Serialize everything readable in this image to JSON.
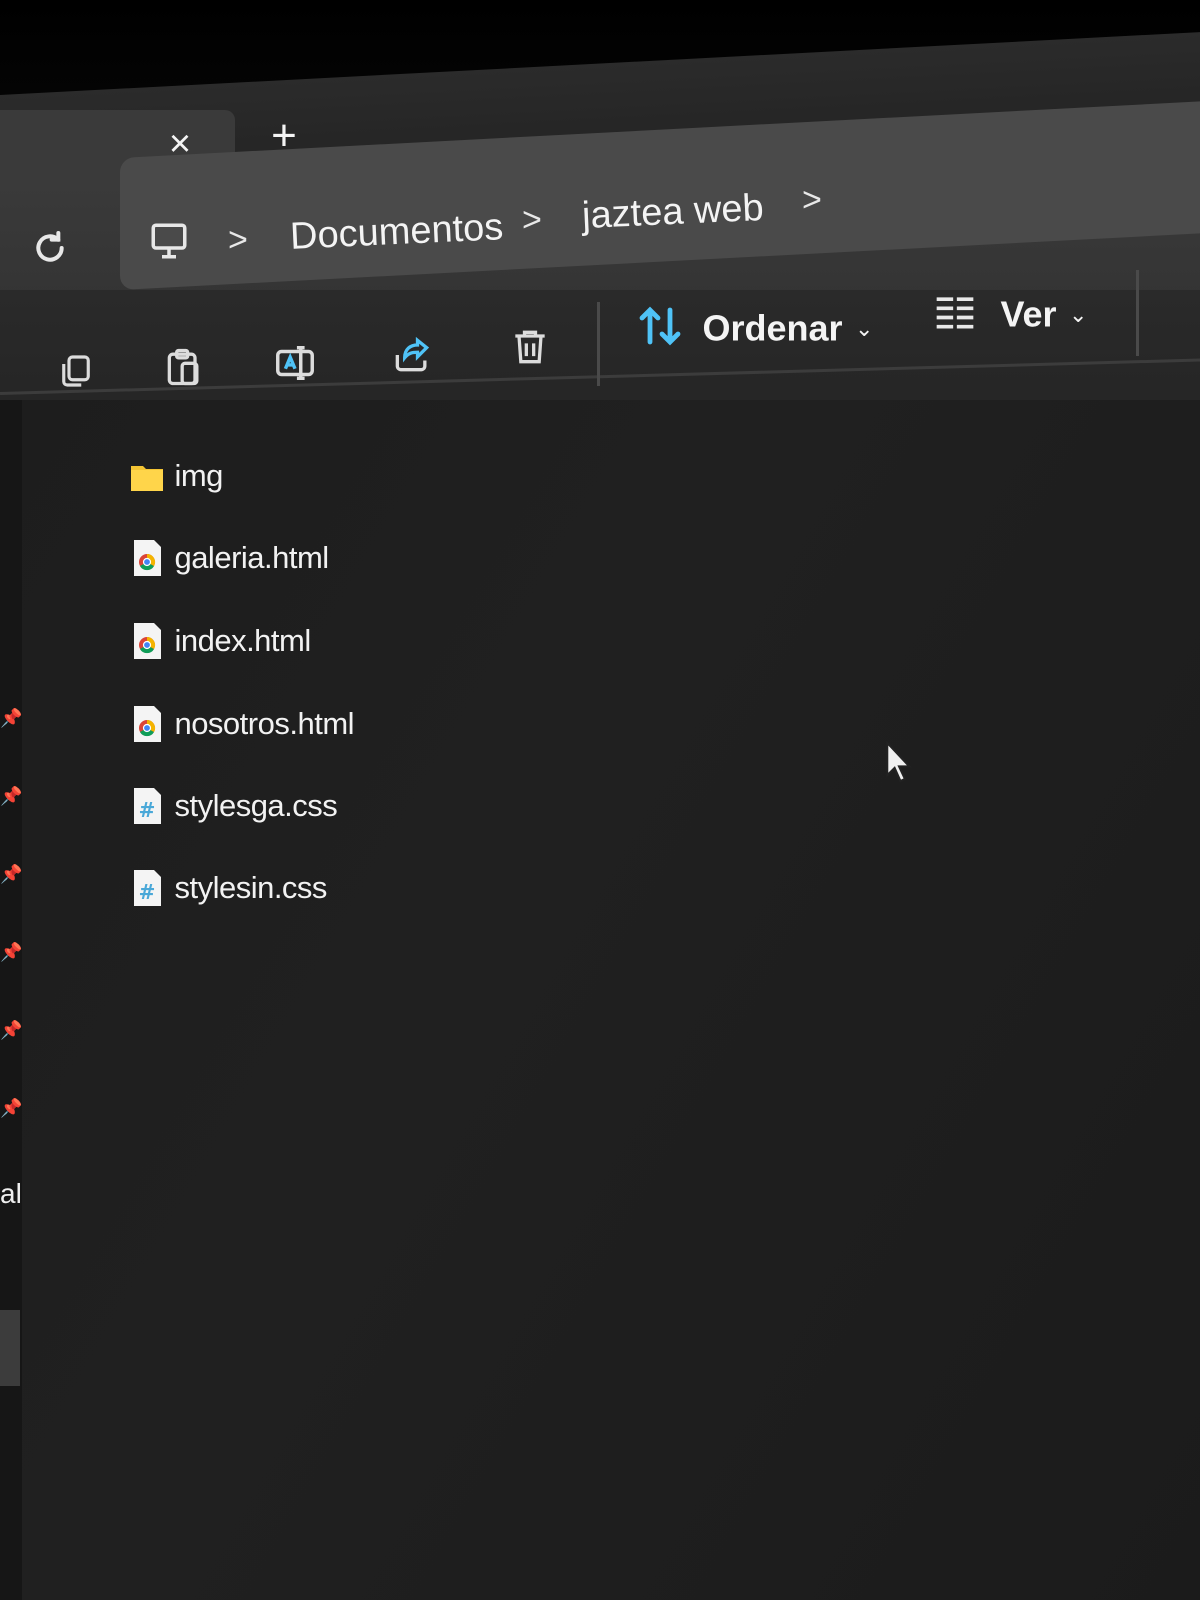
{
  "tabbar": {
    "close_symbol": "×",
    "new_tab_symbol": "+"
  },
  "breadcrumb": {
    "root_icon": "computer-icon",
    "items": [
      "Documentos",
      "jaztea web"
    ],
    "separator": ">"
  },
  "toolbar": {
    "actions": [
      "copy-icon",
      "paste-icon",
      "rename-icon",
      "share-icon",
      "delete-icon"
    ],
    "sort_label": "Ordenar",
    "view_label": "Ver",
    "accent": "#4fc3f7"
  },
  "files": [
    {
      "name": "img",
      "type": "folder",
      "icon": "folder-icon"
    },
    {
      "name": "galeria.html",
      "type": "html",
      "icon": "chrome-html-icon"
    },
    {
      "name": "index.html",
      "type": "html",
      "icon": "chrome-html-icon"
    },
    {
      "name": "nosotros.html",
      "type": "html",
      "icon": "chrome-html-icon"
    },
    {
      "name": "stylesga.css",
      "type": "css",
      "icon": "css-file-icon"
    },
    {
      "name": "stylesin.css",
      "type": "css",
      "icon": "css-file-icon"
    }
  ],
  "navpane": {
    "partial_text": "all"
  },
  "colors": {
    "background": "#1e1e1e",
    "folder": "#f4c534",
    "css_hash": "#4aa8d8"
  }
}
